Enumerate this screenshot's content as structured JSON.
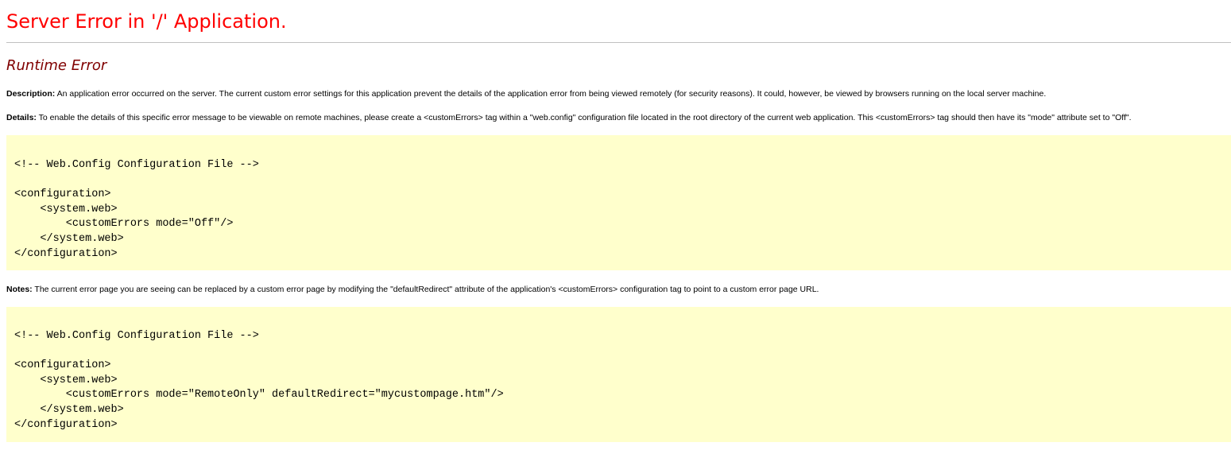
{
  "error": {
    "title": "Server Error in '/' Application.",
    "subtitle": "Runtime Error"
  },
  "description": {
    "label": "Description:",
    "text": " An application error occurred on the server. The current custom error settings for this application prevent the details of the application error from being viewed remotely (for security reasons). It could, however, be viewed by browsers running on the local server machine."
  },
  "details": {
    "label": "Details:",
    "text": " To enable the details of this specific error message to be viewable on remote machines, please create a <customErrors> tag within a \"web.config\" configuration file located in the root directory of the current web application. This <customErrors> tag should then have its \"mode\" attribute set to \"Off\"."
  },
  "code_sample_1": "<!-- Web.Config Configuration File -->\n\n<configuration>\n    <system.web>\n        <customErrors mode=\"Off\"/>\n    </system.web>\n</configuration>",
  "notes": {
    "label": "Notes:",
    "text": " The current error page you are seeing can be replaced by a custom error page by modifying the \"defaultRedirect\" attribute of the application's <customErrors> configuration tag to point to a custom error page URL."
  },
  "code_sample_2": "<!-- Web.Config Configuration File -->\n\n<configuration>\n    <system.web>\n        <customErrors mode=\"RemoteOnly\" defaultRedirect=\"mycustompage.htm\"/>\n    </system.web>\n</configuration>",
  "colors": {
    "title": "#ff0000",
    "subtitle": "#800000",
    "code_background": "#ffffcc",
    "rule": "#c0c0c0"
  }
}
